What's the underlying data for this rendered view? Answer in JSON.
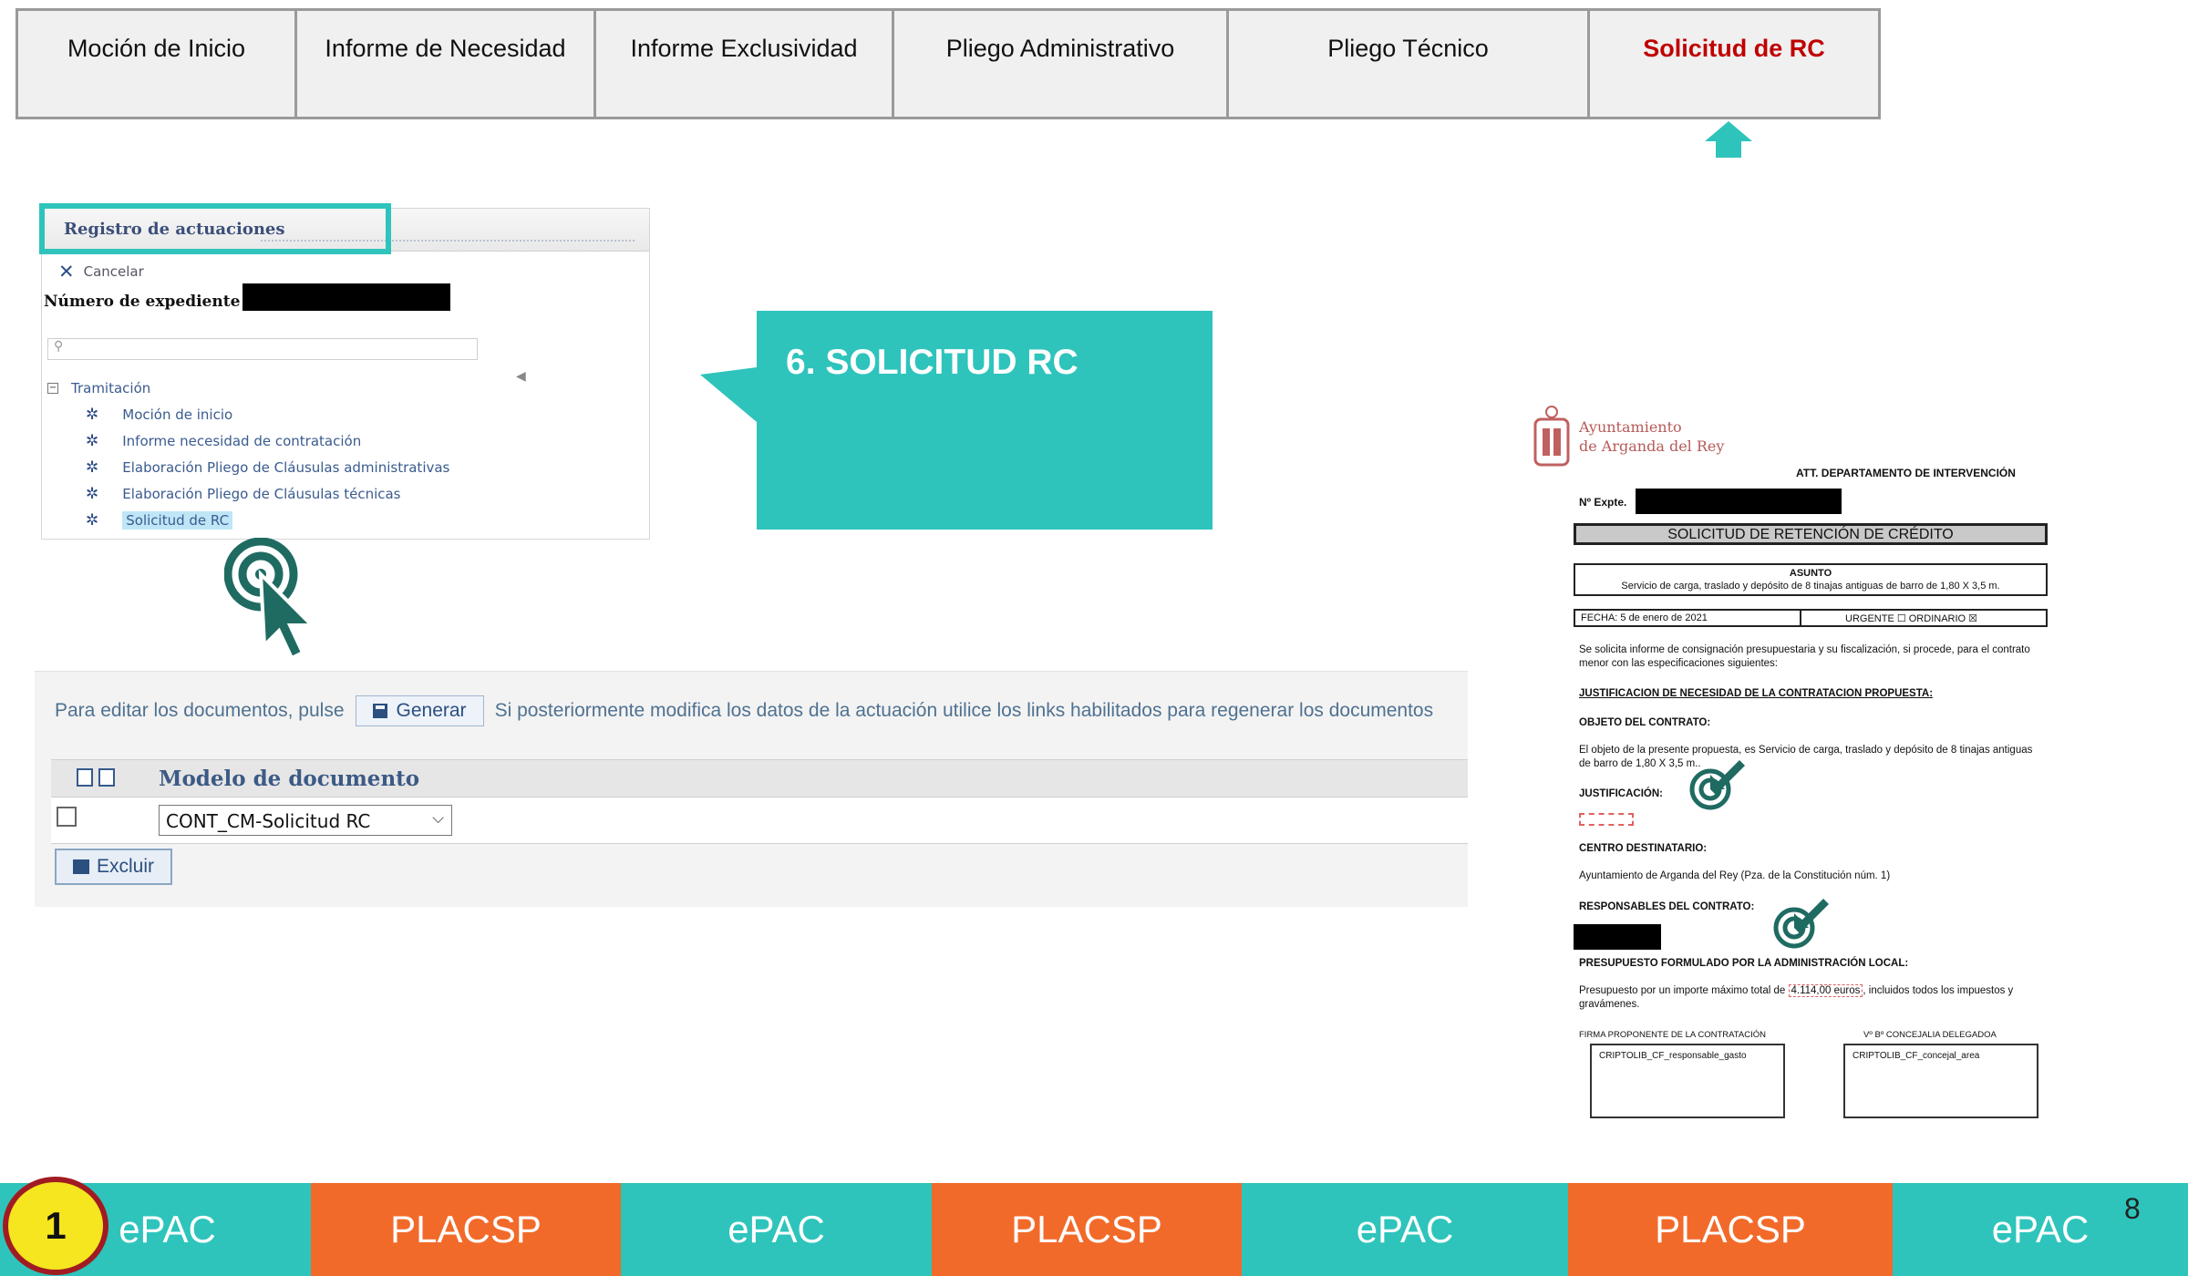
{
  "tabs": [
    {
      "label": "Moción de Inicio"
    },
    {
      "label": "Informe de Necesidad"
    },
    {
      "label": "Informe Exclusividad"
    },
    {
      "label": "Pliego Administrativo"
    },
    {
      "label": "Pliego Técnico"
    },
    {
      "label": "Solicitud de RC"
    }
  ],
  "panel": {
    "title": "Registro de actuaciones",
    "cancel": "Cancelar",
    "expediente_label": "Número de expediente :",
    "tree_root": "Tramitación",
    "tree_items": [
      {
        "label": "Moción de inicio"
      },
      {
        "label": "Informe necesidad de contratación"
      },
      {
        "label": "Elaboración Pliego de Cláusulas administrativas"
      },
      {
        "label": "Elaboración Pliego de Cláusulas técnicas"
      },
      {
        "label": "Solicitud de RC"
      }
    ]
  },
  "callout": {
    "text": "6. SOLICITUD RC"
  },
  "generar": {
    "prefix": "Para editar los documentos, pulse",
    "button": "Generar",
    "suffix": "Si posteriormente modifica los datos de la actuación utilice los links habilitados para regenerar los documentos",
    "column_header": "Modelo de documento",
    "selected_model": "CONT_CM-Solicitud RC",
    "excluir": "Excluir"
  },
  "document": {
    "org_line1": "Ayuntamiento",
    "org_line2": "de Arganda del Rey",
    "att": "ATT. DEPARTAMENTO DE INTERVENCIÓN",
    "nexpte": "Nº Expte.",
    "title": "SOLICITUD DE RETENCIÓN DE CRÉDITO",
    "asunto_label": "ASUNTO",
    "asunto": "Servicio de carga, traslado y depósito de 8 tinajas antiguas de barro de 1,80 X 3,5 m.",
    "fecha": "FECHA:  5 de enero de 2021",
    "urgencia": "URGENTE ☐   ORDINARIO ☒",
    "intro": "Se solicita informe de consignación presupuestaria y su fiscalización, si procede, para el contrato menor con las especificaciones siguientes:",
    "justificacion_heading": "JUSTIFICACION DE NECESIDAD DE LA CONTRATACION  PROPUESTA:",
    "objeto_heading": "OBJETO DEL CONTRATO:",
    "objeto_text": "El objeto de la presente propuesta, es Servicio de carga, traslado y depósito de 8 tinajas antiguas de barro de 1,80 X 3,5 m..",
    "justificacion_label": "JUSTIFICACIÓN:",
    "centro_heading": "CENTRO DESTINATARIO:",
    "centro_text": "Ayuntamiento de Arganda del Rey (Pza. de la Constitución núm. 1)",
    "responsables_heading": "RESPONSABLES DEL CONTRATO:",
    "presupuesto_heading": "PRESUPUESTO FORMULADO POR LA ADMINISTRACIÓN  LOCAL:",
    "presupuesto_pre": "Presupuesto por un importe máximo total de",
    "presupuesto_amount": "4.114,00 euros",
    "presupuesto_post": ", incluidos todos los impuestos y gravámenes.",
    "firma_label": "FIRMA PROPONENTE  DE LA CONTRATACIÓN",
    "vb_label": "Vº Bº CONCEJALIA  DELEGADOA",
    "firma_box": "CRIPTOLIB_CF_responsable_gasto",
    "vb_box": "CRIPTOLIB_CF_concejal_area"
  },
  "bottom_bar": [
    {
      "label": "ePAC",
      "color": "#2ec4bc"
    },
    {
      "label": "PLACSP",
      "color": "#f26a2a"
    },
    {
      "label": "ePAC",
      "color": "#2ec4bc"
    },
    {
      "label": "PLACSP",
      "color": "#f26a2a"
    },
    {
      "label": "ePAC",
      "color": "#2ec4bc"
    },
    {
      "label": "PLACSP",
      "color": "#f26a2a"
    },
    {
      "label": "ePAC",
      "color": "#2ec4bc"
    }
  ],
  "step_badge": "1",
  "page_number": "8",
  "colors": {
    "accent_teal": "#2ec4bc",
    "accent_orange": "#f26a2a",
    "active_tab": "#c00000",
    "icon_dark_teal": "#1f6b62"
  }
}
